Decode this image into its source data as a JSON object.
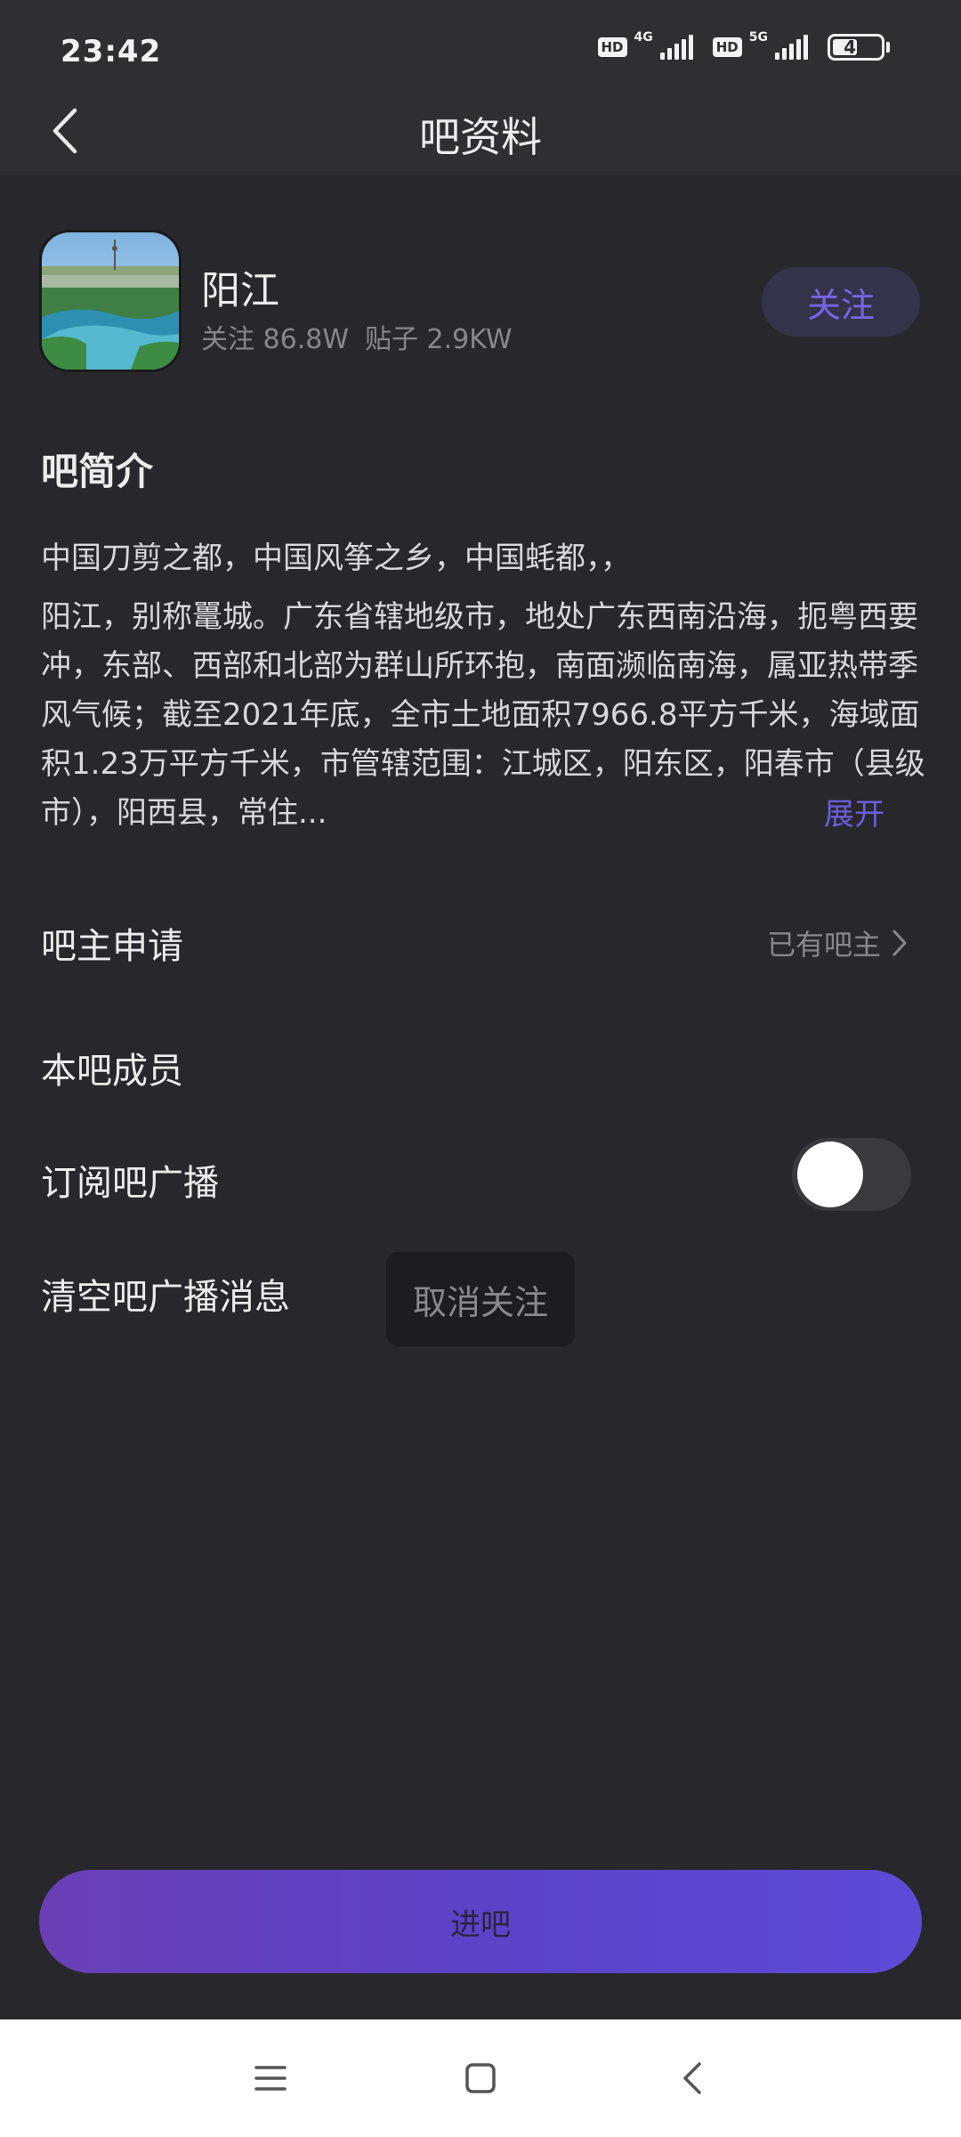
{
  "status_bar": {
    "time": "23:42",
    "hd_badge_1": "HD",
    "network_1": "4G",
    "hd_badge_2": "HD",
    "network_2": "5G",
    "battery": "46"
  },
  "header": {
    "title": "吧资料"
  },
  "bar_info": {
    "name": "阳江",
    "followers": "关注 86.8W",
    "posts": "贴子 2.9KW",
    "follow_label": "关注"
  },
  "intro": {
    "title": "吧简介",
    "line1": "中国刀剪之都，中国风筝之乡，中国蚝都，，",
    "body": "阳江，别称鼍城。广东省辖地级市，地处广东西南沿海，扼粤西要冲，东部、西部和北部为群山所环抱，南面濒临南海，属亚热带季风气候；截至2021年底，全市土地面积7966.8平方千米，海域面积1.23万平方千米，市管辖范围：江城区，阳东区，阳春市（县级市），阳西县，常住...",
    "expand_label": "展开"
  },
  "settings": {
    "owner_apply": {
      "label": "吧主申请",
      "value": "已有吧主"
    },
    "members": {
      "label": "本吧成员"
    },
    "subscribe": {
      "label": "订阅吧广播",
      "enabled": false
    },
    "clear": {
      "label": "清空吧广播消息"
    }
  },
  "toast": {
    "text": "取消关注"
  },
  "enter_button": {
    "label": "进吧"
  },
  "colors": {
    "background": "#28272b",
    "accent": "#6b5ee0",
    "follow_bg": "#35334a",
    "nav_bg": "#ffffff"
  },
  "icons": {
    "back": "chevron-left-icon",
    "chevron": "chevron-right-icon",
    "nav_menu": "menu-icon",
    "nav_home": "home-square-icon",
    "nav_back": "back-icon"
  }
}
